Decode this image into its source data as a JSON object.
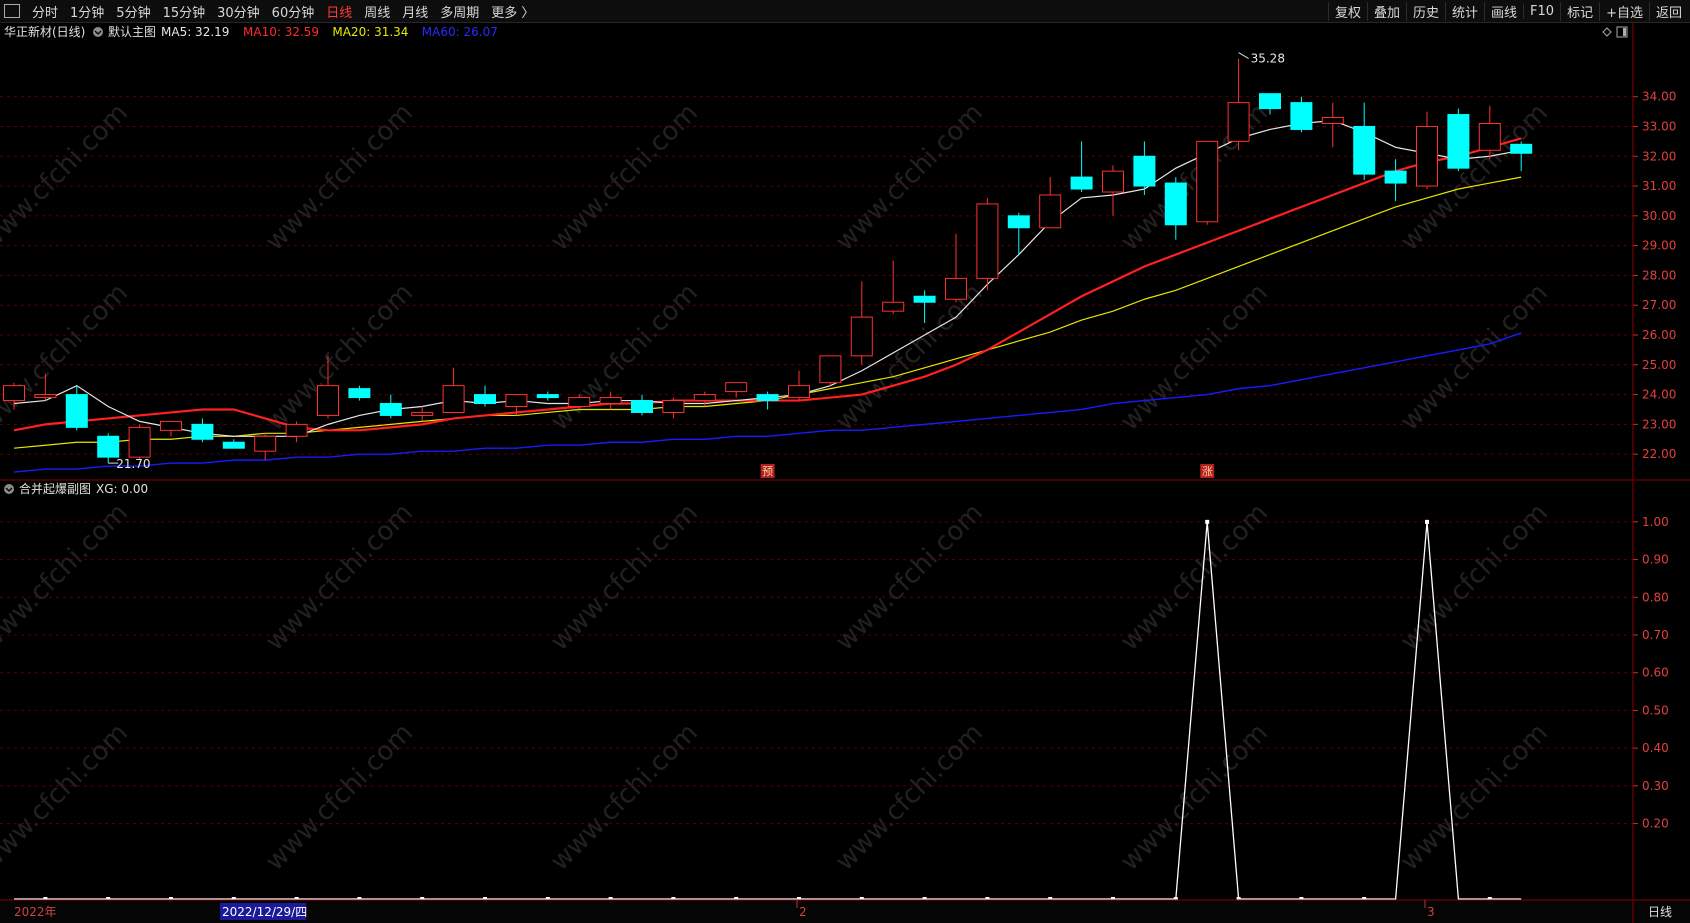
{
  "toolbar": {
    "periods": [
      "分时",
      "1分钟",
      "5分钟",
      "15分钟",
      "30分钟",
      "60分钟",
      "日线",
      "周线",
      "月线",
      "多周期",
      "更多 〉"
    ],
    "active_period": "日线",
    "actions": [
      "复权",
      "叠加",
      "历史",
      "统计",
      "画线",
      "F10",
      "标记",
      "+自选",
      "返回"
    ]
  },
  "main_panel": {
    "stock": "华正新材(日线)",
    "template": "默认主图",
    "ma_labels": [
      {
        "text": "MA5: 32.19",
        "color": "#e6e6e6"
      },
      {
        "text": "MA10: 32.59",
        "color": "#ff2a2a"
      },
      {
        "text": "MA20: 31.34",
        "color": "#e8e800"
      },
      {
        "text": "MA60: 26.07",
        "color": "#2a2aff"
      }
    ],
    "y_ticks": [
      "34.00",
      "33.00",
      "32.00",
      "31.00",
      "30.00",
      "29.00",
      "28.00",
      "27.00",
      "26.00",
      "25.00",
      "24.00",
      "23.00",
      "22.00"
    ],
    "high_label": "35.28",
    "low_label": "21.70",
    "markers": [
      "预",
      "涨"
    ]
  },
  "sub_panel": {
    "title": "合并起爆副图",
    "value_label": "XG: 0.00",
    "y_ticks": [
      "1.00",
      "0.90",
      "0.80",
      "0.70",
      "0.60",
      "0.50",
      "0.40",
      "0.30",
      "0.20"
    ]
  },
  "bottom_bar": {
    "labels": [
      "2022年",
      "2022/12/29/四",
      "2",
      "3"
    ],
    "period": "日线"
  },
  "colors": {
    "up": "#ff3030",
    "down": "#00ffff",
    "ma5": "#e6e6e6",
    "ma10": "#ff2020",
    "ma20": "#e6e600",
    "ma60": "#1a1aff",
    "grid": "#5a0000",
    "watermark": "#ffffff"
  },
  "watermark": "www.cfchi.com",
  "chart_data": {
    "type": "candlestick",
    "candles": [
      {
        "o": 23.8,
        "h": 24.4,
        "l": 23.5,
        "c": 24.3
      },
      {
        "o": 23.9,
        "h": 24.7,
        "l": 23.8,
        "c": 24.0
      },
      {
        "o": 24.0,
        "h": 24.3,
        "l": 22.8,
        "c": 22.9
      },
      {
        "o": 22.6,
        "h": 22.7,
        "l": 21.7,
        "c": 21.9
      },
      {
        "o": 21.9,
        "h": 23.0,
        "l": 21.8,
        "c": 22.9
      },
      {
        "o": 22.8,
        "h": 23.1,
        "l": 22.6,
        "c": 23.1
      },
      {
        "o": 23.0,
        "h": 23.2,
        "l": 22.4,
        "c": 22.5
      },
      {
        "o": 22.4,
        "h": 22.5,
        "l": 22.2,
        "c": 22.2
      },
      {
        "o": 22.1,
        "h": 22.7,
        "l": 21.8,
        "c": 22.6
      },
      {
        "o": 22.6,
        "h": 23.1,
        "l": 22.4,
        "c": 23.0
      },
      {
        "o": 23.3,
        "h": 25.3,
        "l": 23.2,
        "c": 24.3
      },
      {
        "o": 24.2,
        "h": 24.3,
        "l": 23.8,
        "c": 23.9
      },
      {
        "o": 23.7,
        "h": 24.0,
        "l": 23.2,
        "c": 23.3
      },
      {
        "o": 23.3,
        "h": 23.6,
        "l": 23.1,
        "c": 23.4
      },
      {
        "o": 23.4,
        "h": 24.9,
        "l": 23.4,
        "c": 24.3
      },
      {
        "o": 24.0,
        "h": 24.3,
        "l": 23.6,
        "c": 23.7
      },
      {
        "o": 23.6,
        "h": 24.0,
        "l": 23.3,
        "c": 24.0
      },
      {
        "o": 24.0,
        "h": 24.1,
        "l": 23.8,
        "c": 23.9
      },
      {
        "o": 23.6,
        "h": 24.0,
        "l": 23.5,
        "c": 23.9
      },
      {
        "o": 23.7,
        "h": 24.1,
        "l": 23.5,
        "c": 23.9
      },
      {
        "o": 23.8,
        "h": 24.0,
        "l": 23.3,
        "c": 23.4
      },
      {
        "o": 23.4,
        "h": 23.9,
        "l": 23.2,
        "c": 23.8
      },
      {
        "o": 23.8,
        "h": 24.1,
        "l": 23.6,
        "c": 24.0
      },
      {
        "o": 24.1,
        "h": 24.4,
        "l": 23.9,
        "c": 24.4
      },
      {
        "o": 24.0,
        "h": 24.1,
        "l": 23.5,
        "c": 23.8
      },
      {
        "o": 23.9,
        "h": 24.8,
        "l": 23.8,
        "c": 24.3
      },
      {
        "o": 24.4,
        "h": 25.3,
        "l": 24.3,
        "c": 25.3
      },
      {
        "o": 25.3,
        "h": 27.8,
        "l": 25.0,
        "c": 26.6
      },
      {
        "o": 26.8,
        "h": 28.5,
        "l": 26.7,
        "c": 27.1
      },
      {
        "o": 27.3,
        "h": 27.5,
        "l": 26.4,
        "c": 27.1
      },
      {
        "o": 27.2,
        "h": 29.4,
        "l": 27.1,
        "c": 27.9
      },
      {
        "o": 27.9,
        "h": 30.6,
        "l": 27.5,
        "c": 30.4
      },
      {
        "o": 30.0,
        "h": 30.1,
        "l": 28.7,
        "c": 29.6
      },
      {
        "o": 29.6,
        "h": 31.3,
        "l": 29.6,
        "c": 30.7
      },
      {
        "o": 31.3,
        "h": 32.5,
        "l": 30.8,
        "c": 30.9
      },
      {
        "o": 30.8,
        "h": 31.7,
        "l": 30.0,
        "c": 31.5
      },
      {
        "o": 32.0,
        "h": 32.5,
        "l": 30.7,
        "c": 31.0
      },
      {
        "o": 31.1,
        "h": 31.3,
        "l": 29.2,
        "c": 29.7
      },
      {
        "o": 29.8,
        "h": 32.5,
        "l": 29.7,
        "c": 32.5
      },
      {
        "o": 32.5,
        "h": 35.28,
        "l": 32.2,
        "c": 33.8
      },
      {
        "o": 34.1,
        "h": 34.1,
        "l": 33.4,
        "c": 33.6
      },
      {
        "o": 33.8,
        "h": 34.0,
        "l": 32.8,
        "c": 32.9
      },
      {
        "o": 33.1,
        "h": 33.8,
        "l": 32.3,
        "c": 33.3
      },
      {
        "o": 33.0,
        "h": 33.8,
        "l": 31.2,
        "c": 31.4
      },
      {
        "o": 31.5,
        "h": 31.9,
        "l": 30.5,
        "c": 31.1
      },
      {
        "o": 31.0,
        "h": 33.5,
        "l": 30.9,
        "c": 33.0
      },
      {
        "o": 33.4,
        "h": 33.6,
        "l": 31.5,
        "c": 31.6
      },
      {
        "o": 32.2,
        "h": 33.7,
        "l": 31.9,
        "c": 33.1
      },
      {
        "o": 32.4,
        "h": 32.5,
        "l": 31.5,
        "c": 32.1
      }
    ],
    "ma5": [
      23.7,
      23.8,
      24.3,
      23.6,
      23.1,
      22.9,
      22.7,
      22.6,
      22.6,
      22.6,
      23.0,
      23.3,
      23.5,
      23.6,
      23.8,
      23.7,
      23.8,
      23.7,
      23.7,
      23.8,
      23.8,
      23.7,
      23.7,
      23.8,
      23.9,
      24.0,
      24.3,
      24.8,
      25.4,
      26.0,
      26.6,
      27.7,
      28.7,
      29.8,
      30.6,
      30.7,
      30.9,
      31.6,
      32.1,
      32.6,
      32.9,
      33.1,
      33.2,
      32.8,
      32.3,
      32.1,
      31.9,
      32.0,
      32.2
    ],
    "ma10": [
      22.8,
      23.0,
      23.1,
      23.2,
      23.3,
      23.4,
      23.5,
      23.5,
      23.2,
      22.9,
      22.8,
      22.8,
      22.9,
      23.0,
      23.2,
      23.3,
      23.4,
      23.5,
      23.6,
      23.7,
      23.7,
      23.8,
      23.8,
      23.8,
      23.8,
      23.8,
      23.9,
      24.0,
      24.3,
      24.6,
      25.0,
      25.5,
      26.1,
      26.7,
      27.3,
      27.8,
      28.3,
      28.7,
      29.1,
      29.5,
      29.9,
      30.3,
      30.7,
      31.1,
      31.5,
      31.8,
      32.0,
      32.3,
      32.6
    ],
    "ma20": [
      22.2,
      22.3,
      22.4,
      22.4,
      22.5,
      22.5,
      22.6,
      22.6,
      22.7,
      22.7,
      22.8,
      22.9,
      23.0,
      23.1,
      23.2,
      23.3,
      23.3,
      23.4,
      23.5,
      23.5,
      23.5,
      23.6,
      23.6,
      23.7,
      23.8,
      24.0,
      24.2,
      24.4,
      24.6,
      24.9,
      25.2,
      25.5,
      25.8,
      26.1,
      26.5,
      26.8,
      27.2,
      27.5,
      27.9,
      28.3,
      28.7,
      29.1,
      29.5,
      29.9,
      30.3,
      30.6,
      30.9,
      31.1,
      31.3
    ],
    "ma60": [
      21.4,
      21.5,
      21.5,
      21.6,
      21.6,
      21.7,
      21.7,
      21.8,
      21.8,
      21.9,
      21.9,
      22.0,
      22.0,
      22.1,
      22.1,
      22.2,
      22.2,
      22.3,
      22.3,
      22.4,
      22.4,
      22.5,
      22.5,
      22.6,
      22.6,
      22.7,
      22.8,
      22.8,
      22.9,
      23.0,
      23.1,
      23.2,
      23.3,
      23.4,
      23.5,
      23.7,
      23.8,
      23.9,
      24.0,
      24.2,
      24.3,
      24.5,
      24.7,
      24.9,
      25.1,
      25.3,
      25.5,
      25.7,
      26.07
    ],
    "xg": [
      0,
      0,
      0,
      0,
      0,
      0,
      0,
      0,
      0,
      0,
      0,
      0,
      0,
      0,
      0,
      0,
      0,
      0,
      0,
      0,
      0,
      0,
      0,
      0,
      0,
      0,
      0,
      0,
      0,
      0,
      0,
      0,
      0,
      0,
      0,
      0,
      0,
      0,
      1,
      0,
      0,
      0,
      0,
      0,
      0,
      1,
      0,
      0,
      0
    ],
    "marker_index": {
      "预": 24,
      "涨": 38
    },
    "ylim_main": [
      21.2,
      35.6
    ],
    "ylim_sub": [
      0,
      1.05
    ]
  }
}
